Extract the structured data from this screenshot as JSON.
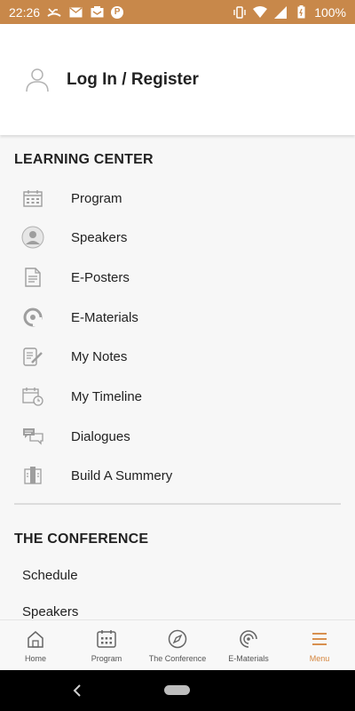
{
  "status_bar": {
    "time": "22:26",
    "p_badge": "P",
    "battery_percent": "100%"
  },
  "login": {
    "label": "Log In / Register",
    "icon": "user-outline-icon"
  },
  "learning_center": {
    "title": "LEARNING CENTER",
    "items": [
      {
        "label": "Program",
        "icon": "calendar-icon"
      },
      {
        "label": "Speakers",
        "icon": "speaker-avatar-icon"
      },
      {
        "label": "E-Posters",
        "icon": "document-icon"
      },
      {
        "label": "E-Materials",
        "icon": "e-materials-icon"
      },
      {
        "label": "My Notes",
        "icon": "notes-pencil-icon"
      },
      {
        "label": "My Timeline",
        "icon": "calendar-clock-icon"
      },
      {
        "label": "Dialogues",
        "icon": "chat-bubbles-icon"
      },
      {
        "label": "Build A Summery",
        "icon": "summary-icon"
      }
    ]
  },
  "conference": {
    "title": "THE CONFERENCE",
    "items": [
      {
        "label": "Schedule"
      },
      {
        "label": "Speakers"
      }
    ]
  },
  "bottom_nav": {
    "items": [
      {
        "label": "Home",
        "icon": "home-icon",
        "active": false
      },
      {
        "label": "Program",
        "icon": "calendar-icon",
        "active": false
      },
      {
        "label": "The Conference",
        "icon": "compass-icon",
        "active": false
      },
      {
        "label": "E-Materials",
        "icon": "e-materials-icon",
        "active": false
      },
      {
        "label": "Menu",
        "icon": "hamburger-icon",
        "active": true
      }
    ]
  },
  "colors": {
    "status_bar": "#c8884a",
    "accent": "#d4843c",
    "icon_gray": "#9e9e9e"
  }
}
